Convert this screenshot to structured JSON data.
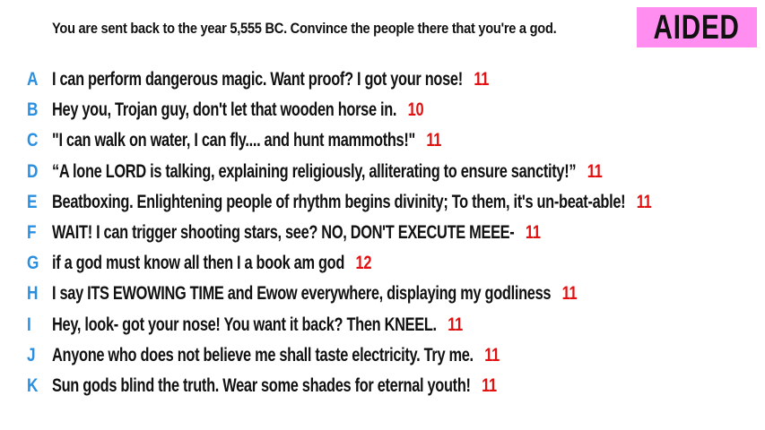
{
  "prompt": "You are sent back to the year 5,555 BC. Convince the people there that you're a god.",
  "badge": "AIDED",
  "colors": {
    "letter": "#2b8fe0",
    "score": "#e11111",
    "badge_bg": "#ff8ef0",
    "text": "#111111"
  },
  "answers": [
    {
      "letter": "A",
      "text": "I can perform dangerous magic. Want proof? I got your nose!",
      "score": "11"
    },
    {
      "letter": "B",
      "text": "Hey you, Trojan guy, don't let that wooden horse in.",
      "score": "10"
    },
    {
      "letter": "C",
      "text": "\"I can walk on water, I can fly.... and hunt mammoths!\"",
      "score": "11"
    },
    {
      "letter": "D",
      "text": "“A lone LORD is talking, explaining religiously, alliterating to ensure sanctity!”",
      "score": "11"
    },
    {
      "letter": "E",
      "text": "Beatboxing. Enlightening people of rhythm begins divinity; To them, it's un-beat-able!",
      "score": "11"
    },
    {
      "letter": "F",
      "text": "WAIT! I can trigger shooting stars, see? NO, DON'T EXECUTE MEEE-",
      "score": "11"
    },
    {
      "letter": "G",
      "text": "if a god must know all then I a book am god",
      "score": "12"
    },
    {
      "letter": "H",
      "text": "I say ITS EWOWING TIME and Ewow everywhere, displaying my godliness",
      "score": "11"
    },
    {
      "letter": "I",
      "text": "Hey, look- got your nose! You want it back? Then KNEEL.",
      "score": "11"
    },
    {
      "letter": "J",
      "text": "Anyone who does not believe me shall taste electricity. Try me.",
      "score": "11"
    },
    {
      "letter": "K",
      "text": "Sun gods blind the truth. Wear some shades for eternal youth!",
      "score": "11"
    }
  ]
}
